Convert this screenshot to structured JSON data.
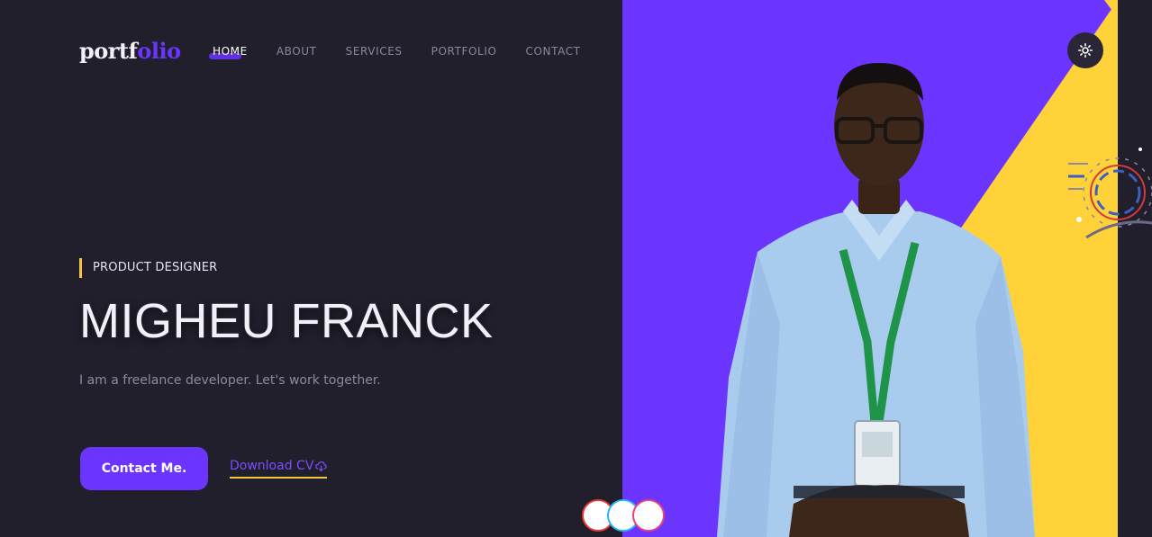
{
  "header": {
    "logo_part1": "portf",
    "logo_part2": "olio",
    "nav": [
      {
        "label": "HOME",
        "active": true
      },
      {
        "label": "ABOUT"
      },
      {
        "label": "SERVICES"
      },
      {
        "label": "PORTFOLIO"
      },
      {
        "label": "CONTACT"
      }
    ]
  },
  "hero": {
    "role": "PRODUCT DESIGNER",
    "name": "MIGHEU FRANCK",
    "tagline": "I am a freelance developer. Let's work together.",
    "contact_label": "Contact Me.",
    "download_label": "Download CV"
  },
  "icons": {
    "theme": "sun-icon",
    "download": "cloud-download-icon"
  },
  "colors": {
    "background": "#221f2d",
    "accent": "#6b35ff",
    "panel_purple": "#6b35ff",
    "panel_yellow": "#ffd23a",
    "underline_yellow": "#f6c445"
  }
}
